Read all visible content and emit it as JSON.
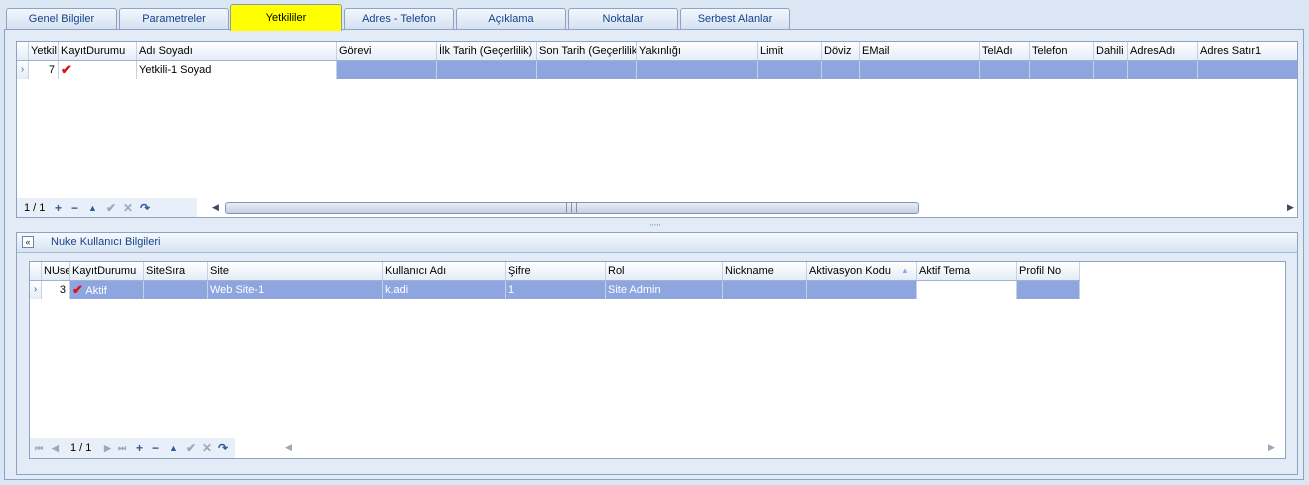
{
  "tabs": [
    {
      "label": "Genel Bilgiler",
      "active": false
    },
    {
      "label": "Parametreler",
      "active": false
    },
    {
      "label": "Yetkililer",
      "active": true
    },
    {
      "label": "Adres - Telefon",
      "active": false
    },
    {
      "label": "Açıklama",
      "active": false
    },
    {
      "label": "Noktalar",
      "active": false
    },
    {
      "label": "Serbest Alanlar",
      "active": false
    }
  ],
  "top_grid": {
    "columns": [
      "Yetkil",
      "KayıtDurumu",
      "Adı Soyadı",
      "Görevi",
      "İlk Tarih (Geçerlilik)",
      "Son Tarih (Geçerlilik)",
      "Yakınlığı",
      "Limit",
      "Döviz",
      "EMail",
      "TelAdı",
      "Telefon",
      "Dahili",
      "AdresAdı",
      "Adres Satır1"
    ],
    "rows": [
      {
        "id": "7",
        "status_icon": "check-icon",
        "status": "Aktif",
        "name": "Yetkili-1 Soyad"
      }
    ],
    "navigator": {
      "position": "1 / 1"
    }
  },
  "splitter_label": ",,,,,",
  "group": {
    "title": "Nuke Kullanıcı Bilgileri",
    "collapse_glyph": "«",
    "grid": {
      "columns": [
        "NUse",
        "KayıtDurumu",
        "SiteSıra",
        "Site",
        "Kullanıcı Adı",
        "Şifre",
        "Rol",
        "Nickname",
        "Aktivasyon Kodu",
        "Aktif Tema",
        "Profil No"
      ],
      "rows": [
        {
          "id": "3",
          "status": "Aktif",
          "site_sira": "",
          "site": "Web Site-1",
          "username": "k.adi",
          "password": "1",
          "role": "Site Admin",
          "nickname": "",
          "activation": "",
          "theme": "",
          "profile": ""
        }
      ],
      "navigator": {
        "position": "1 / 1"
      }
    }
  },
  "colors": {
    "selection": "#8ea5e0",
    "active_tab": "#ffff00",
    "tab_text": "#15428b"
  }
}
